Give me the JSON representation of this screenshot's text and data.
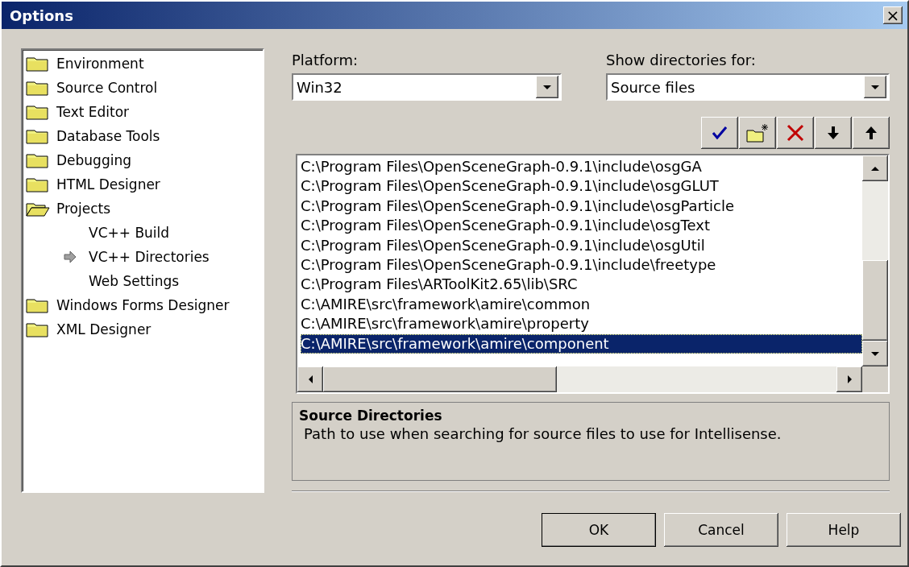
{
  "window": {
    "title": "Options",
    "close": "×"
  },
  "tree": [
    {
      "label": "Environment",
      "selected": false,
      "expanded": false
    },
    {
      "label": "Source Control",
      "selected": false,
      "expanded": false
    },
    {
      "label": "Text Editor",
      "selected": false,
      "expanded": false
    },
    {
      "label": "Database Tools",
      "selected": false,
      "expanded": false
    },
    {
      "label": "Debugging",
      "selected": false,
      "expanded": false
    },
    {
      "label": "HTML Designer",
      "selected": false,
      "expanded": false
    },
    {
      "label": "Projects",
      "selected": false,
      "expanded": true,
      "children": [
        {
          "label": "VC++ Build",
          "selected": false
        },
        {
          "label": "VC++ Directories",
          "selected": true
        },
        {
          "label": "Web Settings",
          "selected": false
        }
      ]
    },
    {
      "label": "Windows Forms Designer",
      "selected": false,
      "expanded": false
    },
    {
      "label": "XML Designer",
      "selected": false,
      "expanded": false
    }
  ],
  "platform": {
    "label": "Platform:",
    "value": "Win32"
  },
  "show_directories_for": {
    "label": "Show directories for:",
    "value": "Source files"
  },
  "toolbar": [
    {
      "kind": "check"
    },
    {
      "kind": "new-folder"
    },
    {
      "kind": "delete"
    },
    {
      "kind": "down"
    },
    {
      "kind": "up"
    }
  ],
  "directories": [
    {
      "path": "C:\\Program Files\\OpenSceneGraph-0.9.1\\include\\osgGA",
      "selected": false
    },
    {
      "path": "C:\\Program Files\\OpenSceneGraph-0.9.1\\include\\osgGLUT",
      "selected": false
    },
    {
      "path": "C:\\Program Files\\OpenSceneGraph-0.9.1\\include\\osgParticle",
      "selected": false
    },
    {
      "path": "C:\\Program Files\\OpenSceneGraph-0.9.1\\include\\osgText",
      "selected": false
    },
    {
      "path": "C:\\Program Files\\OpenSceneGraph-0.9.1\\include\\osgUtil",
      "selected": false
    },
    {
      "path": "C:\\Program Files\\OpenSceneGraph-0.9.1\\include\\freetype",
      "selected": false
    },
    {
      "path": "C:\\Program Files\\ARToolKit2.65\\lib\\SRC",
      "selected": false
    },
    {
      "path": "C:\\AMIRE\\src\\framework\\amire\\common",
      "selected": false
    },
    {
      "path": "C:\\AMIRE\\src\\framework\\amire\\property",
      "selected": false
    },
    {
      "path": "C:\\AMIRE\\src\\framework\\amire\\component",
      "selected": true
    }
  ],
  "description": {
    "title": "Source Directories",
    "text": "Path to use when searching for source files to use for Intellisense."
  },
  "buttons": [
    {
      "label": "OK",
      "kind": "default"
    },
    {
      "label": "Cancel",
      "kind": "normal"
    },
    {
      "label": "Help",
      "kind": "normal"
    }
  ]
}
